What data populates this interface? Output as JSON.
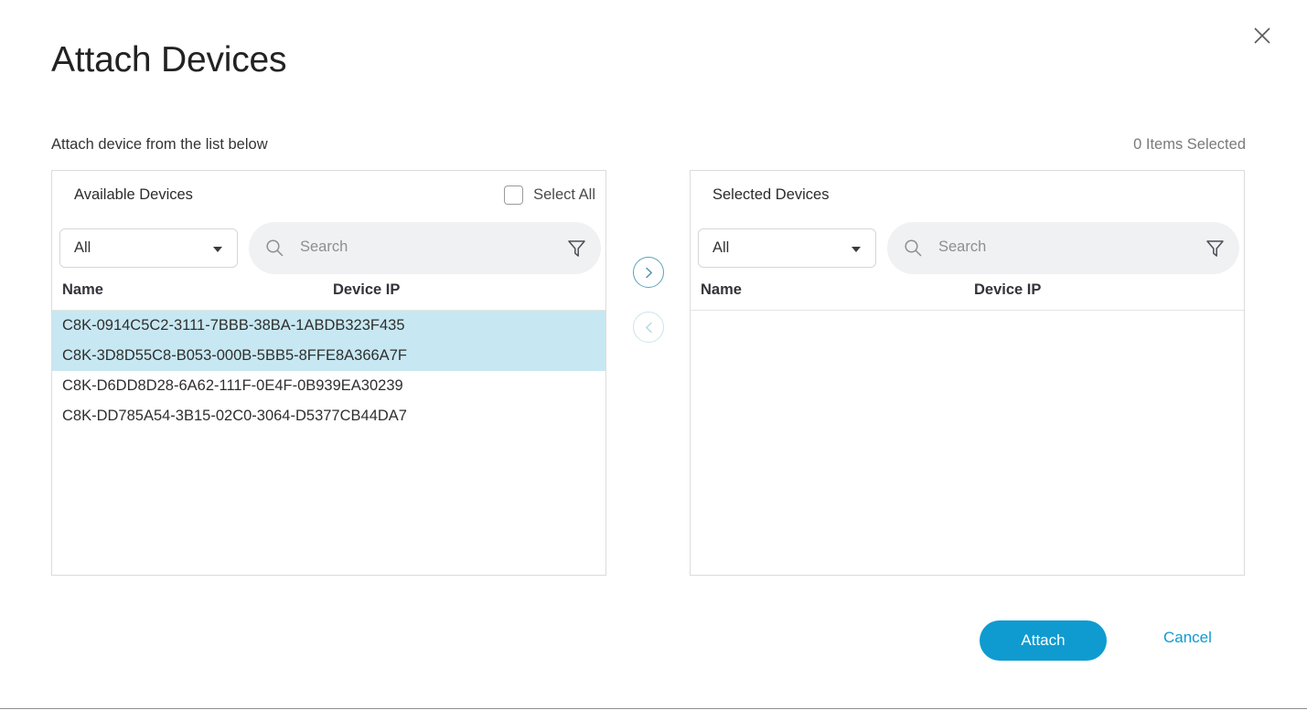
{
  "modal": {
    "title": "Attach Devices",
    "subtitle": "Attach device from the list below",
    "items_selected": "0 Items Selected",
    "close_icon": "close-icon"
  },
  "available_panel": {
    "title": "Available Devices",
    "select_all_label": "Select All",
    "select_all_checked": false,
    "filter": {
      "dropdown_value": "All",
      "dropdown_options": [
        "All"
      ],
      "search_value": "",
      "search_placeholder": "Search",
      "search_icon": "search-icon",
      "funnel_icon": "funnel-icon"
    },
    "columns": [
      "Name",
      "Device IP"
    ],
    "rows": [
      {
        "name": "C8K-0914C5C2-3111-7BBB-38BA-1ABDB323F435",
        "device_ip": "",
        "selected": true
      },
      {
        "name": "C8K-3D8D55C8-B053-000B-5BB5-8FFE8A366A7F",
        "device_ip": "",
        "selected": true
      },
      {
        "name": "C8K-D6DD8D28-6A62-111F-0E4F-0B939EA30239",
        "device_ip": "",
        "selected": false
      },
      {
        "name": "C8K-DD785A54-3B15-02C0-3064-D5377CB44DA7",
        "device_ip": "",
        "selected": false
      }
    ]
  },
  "transfer": {
    "move_right_icon": "chevron-right-circle-icon",
    "move_right_enabled": true,
    "move_left_icon": "chevron-left-circle-icon",
    "move_left_enabled": false
  },
  "selected_panel": {
    "title": "Selected Devices",
    "filter": {
      "dropdown_value": "All",
      "dropdown_options": [
        "All"
      ],
      "search_value": "",
      "search_placeholder": "Search",
      "search_icon": "search-icon",
      "funnel_icon": "funnel-icon"
    },
    "columns": [
      "Name",
      "Device IP"
    ],
    "rows": []
  },
  "footer": {
    "attach_label": "Attach",
    "cancel_label": "Cancel"
  },
  "colors": {
    "accent": "#0f9bd0",
    "row_selected": "#c7e8f2",
    "search_bg": "#f0f1f3",
    "panel_border": "#dcdcdc",
    "muted_text": "#7a7a7a"
  }
}
